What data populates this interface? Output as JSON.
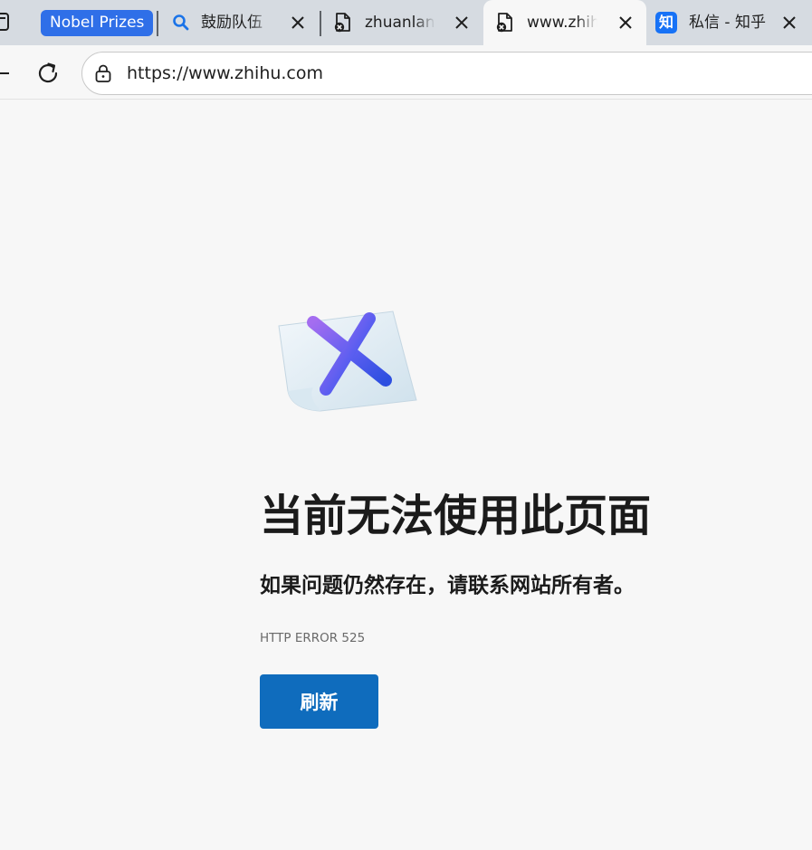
{
  "tabs": {
    "group_chip": "Nobel Prizes",
    "items": [
      {
        "title": "鼓励队伍",
        "icon": "search-icon",
        "active": false
      },
      {
        "title": "zhuanlan.zhihu",
        "icon": "page-error-icon",
        "active": false
      },
      {
        "title": "www.zhihu",
        "icon": "page-error-icon",
        "active": true
      },
      {
        "title": "私信 - 知乎",
        "icon": "zhihu-logo-icon",
        "active": false
      }
    ],
    "zhihu_logo_text": "知"
  },
  "toolbar": {
    "url": "https://www.zhihu.com"
  },
  "error": {
    "title": "当前无法使用此页面",
    "subtitle": "如果问题仍然存在，请联系网站所有者。",
    "code": "HTTP ERROR 525",
    "refresh_label": "刷新"
  },
  "colors": {
    "accent": "#0f6cbd",
    "group_chip": "#2f6fe8",
    "zhihu_blue": "#1772f6",
    "page_bg": "#f7f7f7",
    "tabstrip_bg": "#d6dbe1"
  }
}
